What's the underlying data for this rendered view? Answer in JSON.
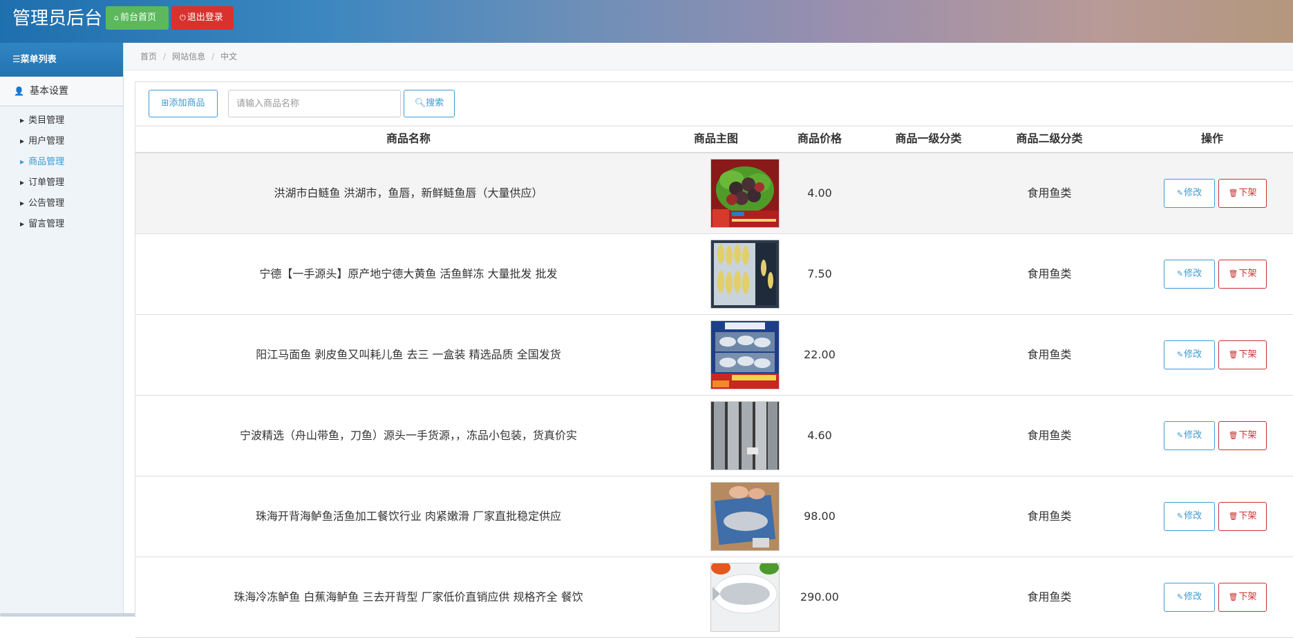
{
  "header": {
    "title": "管理员后台",
    "home_button": "前台首页",
    "logout_button": "退出登录"
  },
  "sidebar": {
    "menu_title": "菜单列表",
    "group": "基本设置",
    "items": [
      {
        "label": "类目管理",
        "active": false
      },
      {
        "label": "用户管理",
        "active": false
      },
      {
        "label": "商品管理",
        "active": true
      },
      {
        "label": "订单管理",
        "active": false
      },
      {
        "label": "公告管理",
        "active": false
      },
      {
        "label": "留言管理",
        "active": false
      }
    ]
  },
  "breadcrumb": [
    "首页",
    "网站信息",
    "中文"
  ],
  "toolbar": {
    "add_label": "添加商品",
    "search_placeholder": "请输入商品名称",
    "search_label": "搜索"
  },
  "table": {
    "headers": [
      "商品名称",
      "商品主图",
      "商品价格",
      "商品一级分类",
      "商品二级分类",
      "操作"
    ],
    "edit_label": "修改",
    "delist_label": "下架",
    "rows": [
      {
        "name": "洪湖市白鲢鱼 洪湖市，鱼唇，新鲜鲢鱼唇（大量供应）",
        "price": "4.00",
        "cat1": "",
        "cat2": "食用鱼类",
        "image": "fish-lips-on-lettuce"
      },
      {
        "name": "宁德【一手源头】原产地宁德大黄鱼 活鱼鲜冻 大量批发 批发",
        "price": "7.50",
        "cat1": "",
        "cat2": "食用鱼类",
        "image": "yellow-croaker-trays"
      },
      {
        "name": "阳江马面鱼 剥皮鱼又叫耗儿鱼 去三 一盒装 精选品质 全国发货",
        "price": "22.00",
        "cat1": "",
        "cat2": "食用鱼类",
        "image": "filefish-box"
      },
      {
        "name": "宁波精选（舟山带鱼，刀鱼）源头一手货源，，冻品小包装，货真价实",
        "price": "4.60",
        "cat1": "",
        "cat2": "食用鱼类",
        "image": "hairtail-fish"
      },
      {
        "name": "珠海开背海鲈鱼活鱼加工餐饮行业 肉紧嫩滑 厂家直批稳定供应",
        "price": "98.00",
        "cat1": "",
        "cat2": "食用鱼类",
        "image": "sea-bass-in-bag"
      },
      {
        "name": "珠海冷冻鲈鱼 白蕉海鲈鱼 三去开背型 厂家低价直销应供 规格齐全 餐饮",
        "price": "290.00",
        "cat1": "",
        "cat2": "食用鱼类",
        "image": "sea-bass-on-plate"
      }
    ]
  }
}
